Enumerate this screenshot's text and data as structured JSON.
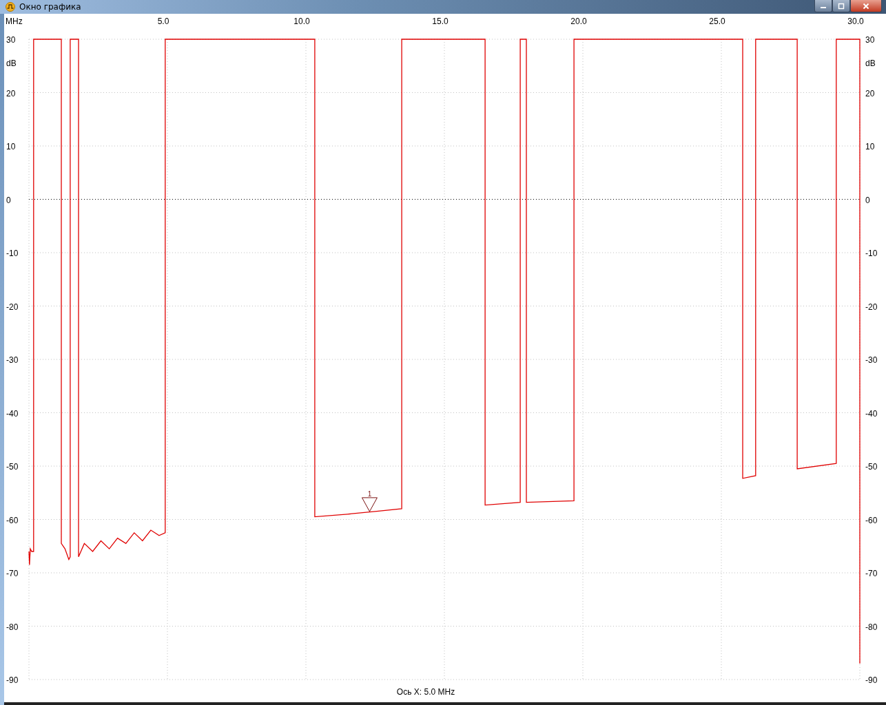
{
  "window": {
    "title": "Окно графика"
  },
  "plot": {
    "chart_data": {
      "type": "line",
      "xlabel": "MHz",
      "ylabel": "dB",
      "xlim": [
        0,
        30
      ],
      "ylim": [
        -90,
        30
      ],
      "xticks": [
        {
          "value": 5,
          "label": "5.0"
        },
        {
          "value": 10,
          "label": "10.0"
        },
        {
          "value": 15,
          "label": "15.0"
        },
        {
          "value": 20,
          "label": "20.0"
        },
        {
          "value": 25,
          "label": "25.0"
        },
        {
          "value": 30,
          "label": "30.0"
        }
      ],
      "yticks": [
        30,
        20,
        10,
        0,
        -10,
        -20,
        -30,
        -40,
        -50,
        -60,
        -70,
        -80,
        -90
      ],
      "grid": true,
      "ref_lines": [
        {
          "axis": "y",
          "value": 0
        }
      ],
      "x": [
        0.0,
        0.02,
        0.05,
        0.1,
        0.17,
        0.17,
        1.17,
        1.17,
        1.3,
        1.44,
        1.49,
        1.49,
        1.79,
        1.79,
        2.0,
        2.3,
        2.6,
        2.9,
        3.2,
        3.5,
        3.8,
        4.1,
        4.4,
        4.7,
        4.92,
        4.92,
        10.32,
        10.32,
        11.5,
        12.5,
        13.46,
        13.46,
        16.47,
        16.47,
        17.74,
        17.74,
        17.96,
        17.96,
        19.68,
        19.68,
        25.77,
        25.77,
        26.24,
        26.24,
        27.74,
        27.74,
        29.15,
        29.15,
        30.0,
        30.0
      ],
      "series": [
        {
          "color": "#e00000",
          "values": [
            -66,
            -68.5,
            -65.5,
            -66,
            -66,
            30,
            30,
            -64.5,
            -65.5,
            -67.5,
            -67,
            30,
            30,
            -67,
            -64.5,
            -66,
            -64,
            -65.5,
            -63.5,
            -64.5,
            -62.5,
            -64,
            -62,
            -63,
            -62.5,
            30,
            30,
            -59.5,
            -59,
            -58.5,
            -58,
            30,
            30,
            -57.3,
            -56.8,
            30,
            30,
            -56.8,
            -56.5,
            30,
            30,
            -52.3,
            -51.8,
            30,
            30,
            -50.5,
            -49.5,
            30,
            30,
            -87
          ]
        }
      ],
      "annotations": [
        {
          "x": 12.3,
          "y": -58.5,
          "text": "1"
        }
      ]
    },
    "right_axis": {
      "unit": "dB",
      "ticks": [
        "30",
        "20",
        "10",
        "0",
        "-10",
        "-20",
        "-30",
        "-40",
        "-50",
        "-60",
        "-70",
        "-80",
        "-90"
      ]
    }
  },
  "status": "Ось X: 5.0 MHz"
}
